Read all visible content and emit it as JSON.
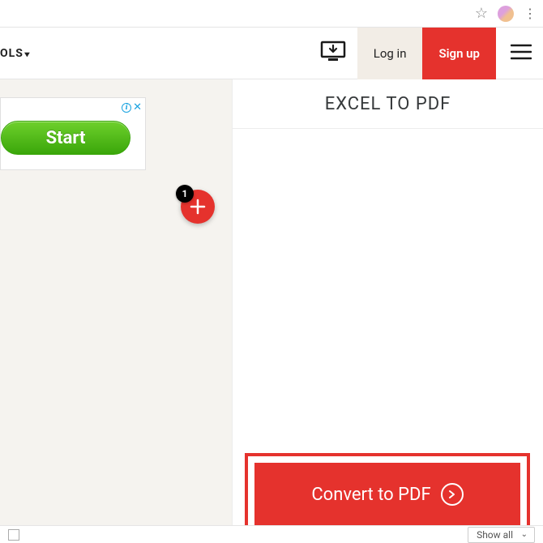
{
  "browser": {},
  "header": {
    "tools_label": "OLS",
    "login_label": "Log in",
    "signup_label": "Sign up"
  },
  "ad": {
    "start_label": "Start"
  },
  "add": {
    "badge_count": "1"
  },
  "right": {
    "title": "EXCEL TO PDF"
  },
  "convert": {
    "label": "Convert to PDF"
  },
  "footer": {
    "show_all": "Show all"
  }
}
